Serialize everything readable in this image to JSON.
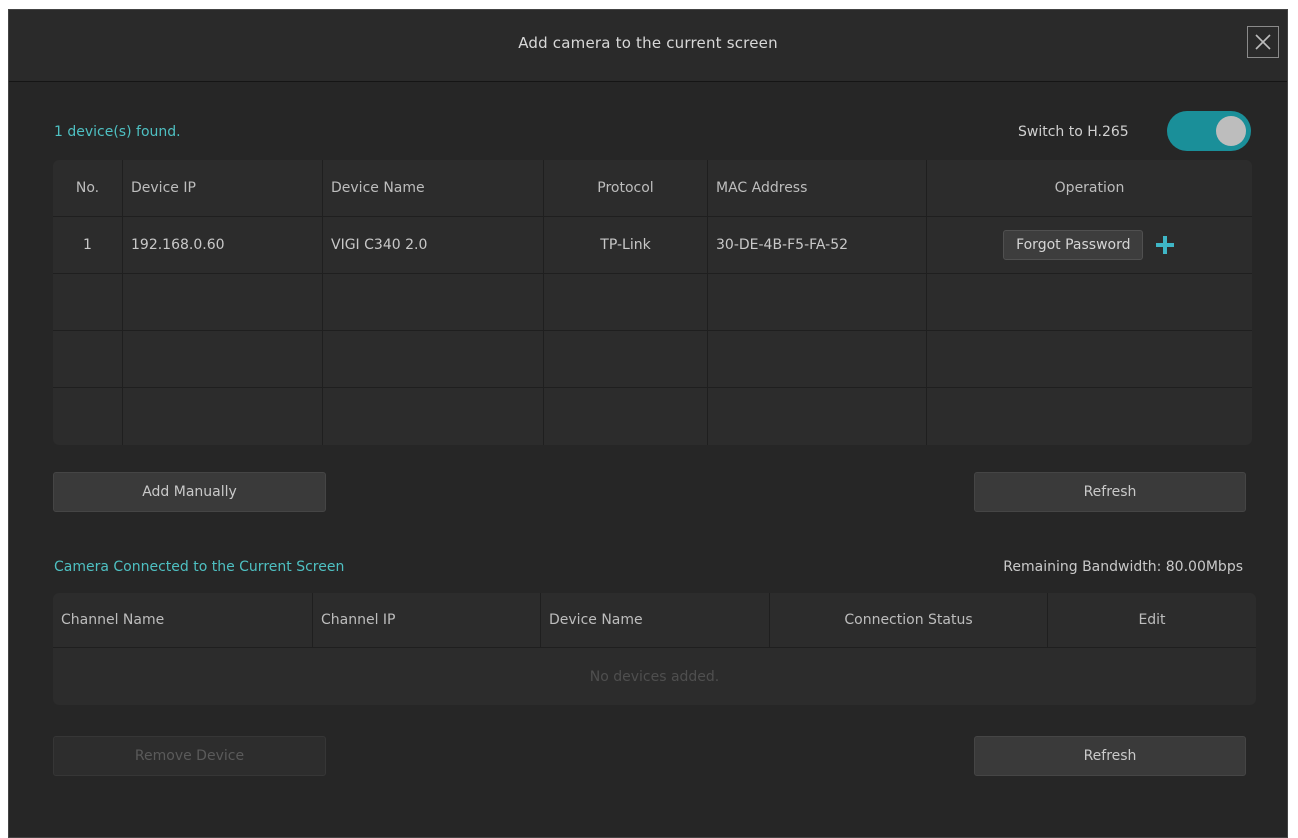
{
  "dialog": {
    "title": "Add camera to the current screen"
  },
  "discovery": {
    "found_text": "1 device(s) found.",
    "h265_label": "Switch to H.265",
    "h265_enabled": true,
    "columns": {
      "no": "No.",
      "ip": "Device IP",
      "name": "Device Name",
      "protocol": "Protocol",
      "mac": "MAC Address",
      "operation": "Operation"
    },
    "rows": [
      {
        "no": "1",
        "ip": "192.168.0.60",
        "name": "VIGI C340 2.0",
        "protocol": "TP-Link",
        "mac": "30-DE-4B-F5-FA-52",
        "action_label": "Forgot Password"
      }
    ],
    "add_manually_label": "Add Manually",
    "refresh_label": "Refresh"
  },
  "connected": {
    "section_title": "Camera Connected to the Current Screen",
    "bandwidth_text": "Remaining Bandwidth: 80.00Mbps",
    "columns": {
      "channel_name": "Channel Name",
      "channel_ip": "Channel IP",
      "device_name": "Device Name",
      "status": "Connection Status",
      "edit": "Edit"
    },
    "empty_message": "No devices added.",
    "remove_label": "Remove Device",
    "refresh_label": "Refresh"
  },
  "colors": {
    "accent": "#1a8f99",
    "accent_text": "#4ec0c2",
    "plus_icon": "#3fb6c6",
    "background": "#262626"
  },
  "icons": {
    "close": "close-icon",
    "add": "plus-icon"
  }
}
